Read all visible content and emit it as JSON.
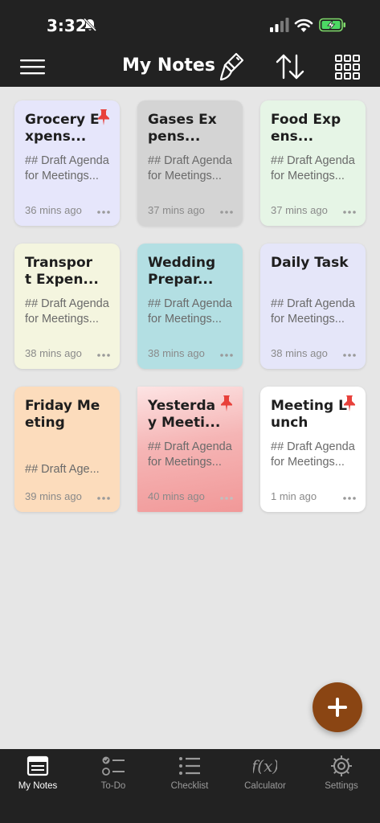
{
  "status": {
    "time": "3:32"
  },
  "header": {
    "title": "My Notes"
  },
  "notes": [
    {
      "title": "Grocery Expens...",
      "body": "## Draft Agenda for Meetings...",
      "time": "36 mins ago",
      "color": "#e6e6fb",
      "pinned": true
    },
    {
      "title": "Gases Expens...",
      "body": "## Draft Agenda for Meetings...",
      "time": "37 mins ago",
      "color": "#d4d4d4",
      "pinned": false
    },
    {
      "title": "Food Expens...",
      "body": "## Draft Agenda for Meetings...",
      "time": "37 mins ago",
      "color": "#e6f5e6",
      "pinned": false
    },
    {
      "title": "Transpor t Expen...",
      "body": "## Draft Agenda for Meetings...",
      "time": "38 mins ago",
      "color": "#f4f5df",
      "pinned": false
    },
    {
      "title": "Wedding Prepar...",
      "body": "## Draft Agenda for Meetings...",
      "time": "38 mins ago",
      "color": "#b3dfe3",
      "pinned": false
    },
    {
      "title": "Daily Task",
      "body": "## Draft Agenda for Meetings...",
      "time": "38 mins ago",
      "color": "#e5e6f9",
      "pinned": false
    },
    {
      "title": "Friday Meeting",
      "body": "## Draft Age...",
      "time": "39 mins ago",
      "color": "#fcdcbc",
      "pinned": false
    },
    {
      "title": "Yesterda y Meeti...",
      "body": "## Draft Agenda for Meetings...",
      "time": "40 mins ago",
      "color": "#f19898",
      "pinned": true
    },
    {
      "title": "Meeting Lunch",
      "body": "## Draft Agenda for Meetings...",
      "time": "1 min ago",
      "color": "#ffffff",
      "pinned": true
    }
  ],
  "colors": {
    "pin": "#e8413b",
    "fab": "#8a4513",
    "bar": "#222222"
  },
  "nav": [
    {
      "label": "My Notes",
      "icon": "notes-icon",
      "active": true
    },
    {
      "label": "To-Do",
      "icon": "todo-icon",
      "active": false
    },
    {
      "label": "Checklist",
      "icon": "checklist-icon",
      "active": false
    },
    {
      "label": "Calculator",
      "icon": "function-icon",
      "active": false
    },
    {
      "label": "Settings",
      "icon": "gear-icon",
      "active": false
    }
  ]
}
